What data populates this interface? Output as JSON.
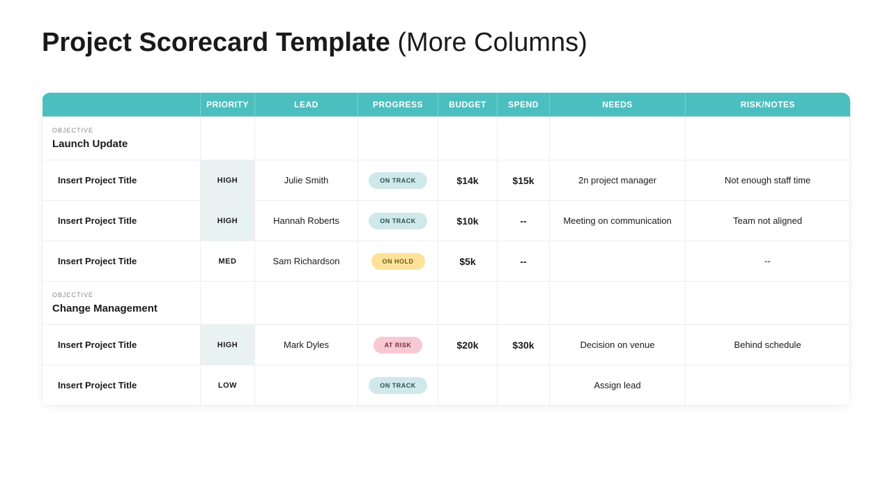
{
  "title_bold": "Project Scorecard Template",
  "title_rest": " (More Columns)",
  "headers": {
    "blank": "",
    "priority": "PRIORITY",
    "lead": "LEAD",
    "progress": "PROGRESS",
    "budget": "BUDGET",
    "spend": "SPEND",
    "needs": "NEEDS",
    "risk": "RISK/NOTES"
  },
  "objective_label": "OBJECTIVE",
  "groups": [
    {
      "name": "Launch Update",
      "rows": [
        {
          "title": "Insert Project Title",
          "priority": "HIGH",
          "priority_bg": true,
          "lead": "Julie Smith",
          "progress": "ON TRACK",
          "progress_type": "ontrack",
          "budget": "$14k",
          "spend": "$15k",
          "needs": "2n project manager",
          "risk": "Not enough staff time"
        },
        {
          "title": "Insert Project Title",
          "priority": "HIGH",
          "priority_bg": true,
          "lead": "Hannah Roberts",
          "progress": "ON TRACK",
          "progress_type": "ontrack",
          "budget": "$10k",
          "spend": "--",
          "needs": "Meeting on communication",
          "risk": "Team not aligned"
        },
        {
          "title": "Insert Project Title",
          "priority": "MED",
          "priority_bg": false,
          "lead": "Sam Richardson",
          "progress": "ON HOLD",
          "progress_type": "onhold",
          "budget": "$5k",
          "spend": "--",
          "needs": "",
          "risk": "--"
        }
      ]
    },
    {
      "name": "Change Management",
      "rows": [
        {
          "title": "Insert Project Title",
          "priority": "HIGH",
          "priority_bg": true,
          "lead": "Mark Dyles",
          "progress": "AT RISK",
          "progress_type": "atrisk",
          "budget": "$20k",
          "spend": "$30k",
          "needs": "Decision on venue",
          "risk": "Behind schedule"
        },
        {
          "title": "Insert Project Title",
          "priority": "LOW",
          "priority_bg": false,
          "lead": "",
          "progress": "ON TRACK",
          "progress_type": "ontrack",
          "budget": "",
          "spend": "",
          "needs": "Assign lead",
          "risk": ""
        }
      ]
    }
  ]
}
